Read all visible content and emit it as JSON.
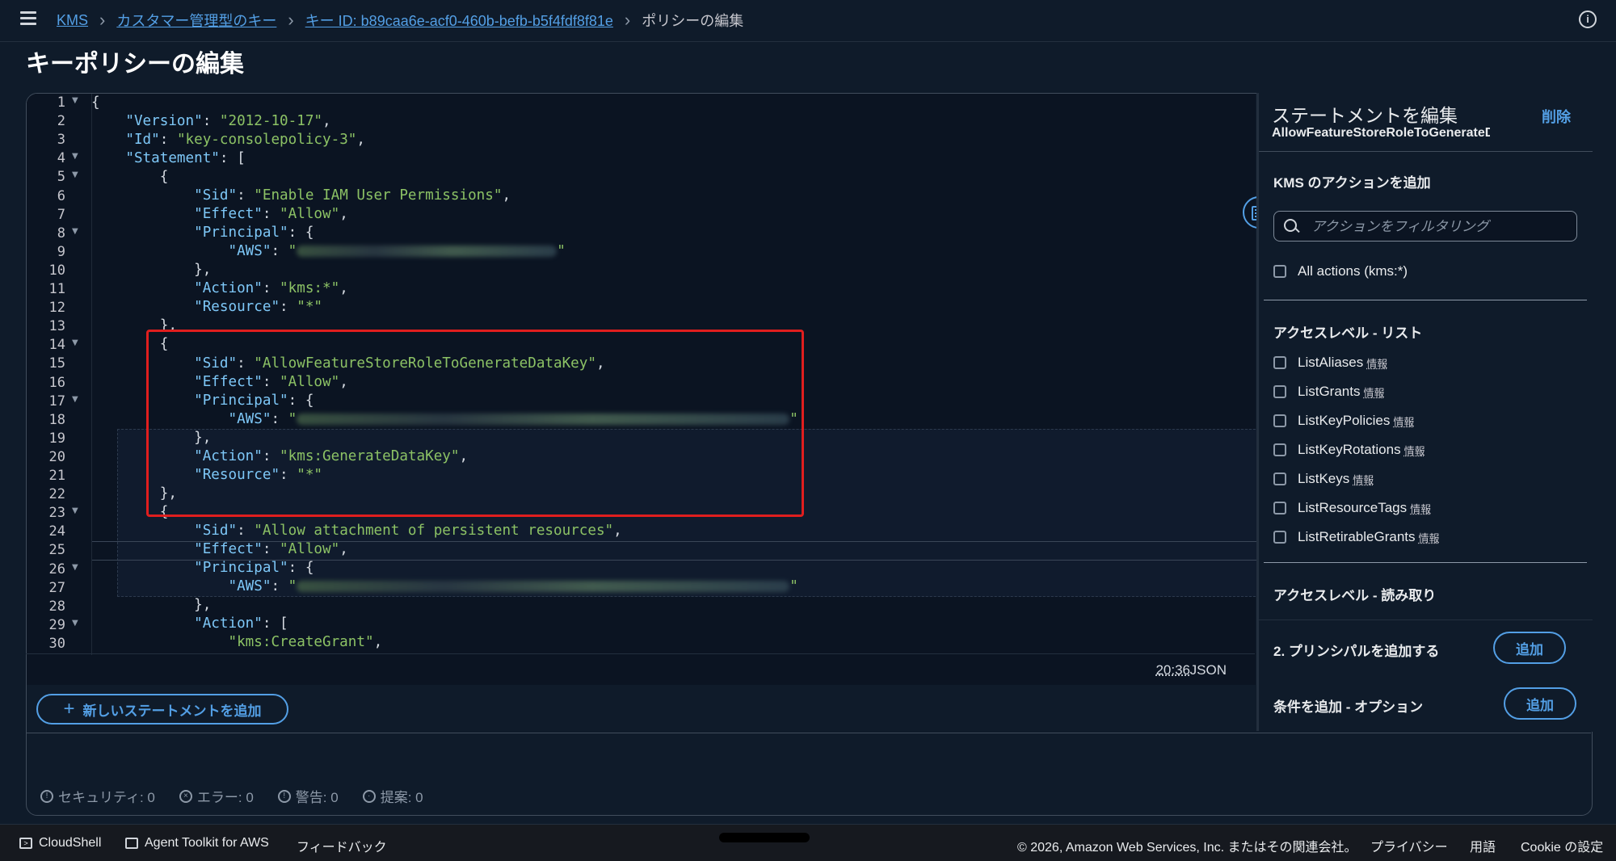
{
  "topbar": {
    "breadcrumb": [
      "KMS",
      "カスタマー管理型のキー",
      "キー ID: b89caa6e-acf0-460b-befb-b5f4fdf8f81e"
    ],
    "current": "ポリシーの編集"
  },
  "page_title": "キーポリシーの編集",
  "editor": {
    "cursor_position": "20:36",
    "language": "JSON",
    "add_statement_label": "新しいステートメントを追加"
  },
  "code": {
    "version_key": "\"Version\"",
    "version_val": "\"2012-10-17\"",
    "id_key": "\"Id\"",
    "id_val": "\"key-consolepolicy-3\"",
    "statement_key": "\"Statement\"",
    "sid_key": "\"Sid\"",
    "effect_key": "\"Effect\"",
    "principal_key": "\"Principal\"",
    "aws_key": "\"AWS\"",
    "action_key": "\"Action\"",
    "resource_key": "\"Resource\"",
    "allow": "\"Allow\"",
    "star": "\"*\"",
    "quote": "\"",
    "sid1": "\"Enable IAM User Permissions\"",
    "action1": "\"kms:*\"",
    "sid2": "\"AllowFeatureStoreRoleToGenerateDataKey\"",
    "action2": "\"kms:GenerateDataKey\"",
    "sid3": "\"Allow attachment of persistent resources\"",
    "action3": "\"kms:CreateGrant\""
  },
  "status": {
    "security": "セキュリティ: 0",
    "errors": "エラー: 0",
    "warnings": "警告: 0",
    "suggestions": "提案: 0"
  },
  "side_panel": {
    "title": "ステートメントを編集",
    "subtitle": "AllowFeatureStoreRoleToGenerateDataKey",
    "delete_label": "削除",
    "kms_actions_title": "KMS のアクションを追加",
    "filter_placeholder": "アクションをフィルタリング",
    "all_actions": "All actions (kms:*)",
    "list_group_title": "アクセスレベル - リスト",
    "list_actions": [
      "ListAliases",
      "ListGrants",
      "ListKeyPolicies",
      "ListKeyRotations",
      "ListKeys",
      "ListResourceTags",
      "ListRetirableGrants"
    ],
    "info_label": "情報",
    "read_group_title": "アクセスレベル - 読み取り",
    "add_principal_label": "2. プリンシパルを追加する",
    "add_condition_label": "条件を追加 - オプション",
    "add_button": "追加"
  },
  "footer": {
    "cloudshell": "CloudShell",
    "agent_toolkit": "Agent Toolkit for AWS",
    "feedback": "フィードバック",
    "copyright": "© 2026, Amazon Web Services, Inc. またはその関連会社。",
    "privacy": "プライバシー",
    "terms": "用語",
    "cookie": "Cookie の設定"
  },
  "colors": {
    "background": "#0f1b2a",
    "accent": "#539fe5",
    "json_key": "#7ec8f8",
    "json_string": "#8cc265",
    "highlight_box": "#e01e1e"
  }
}
